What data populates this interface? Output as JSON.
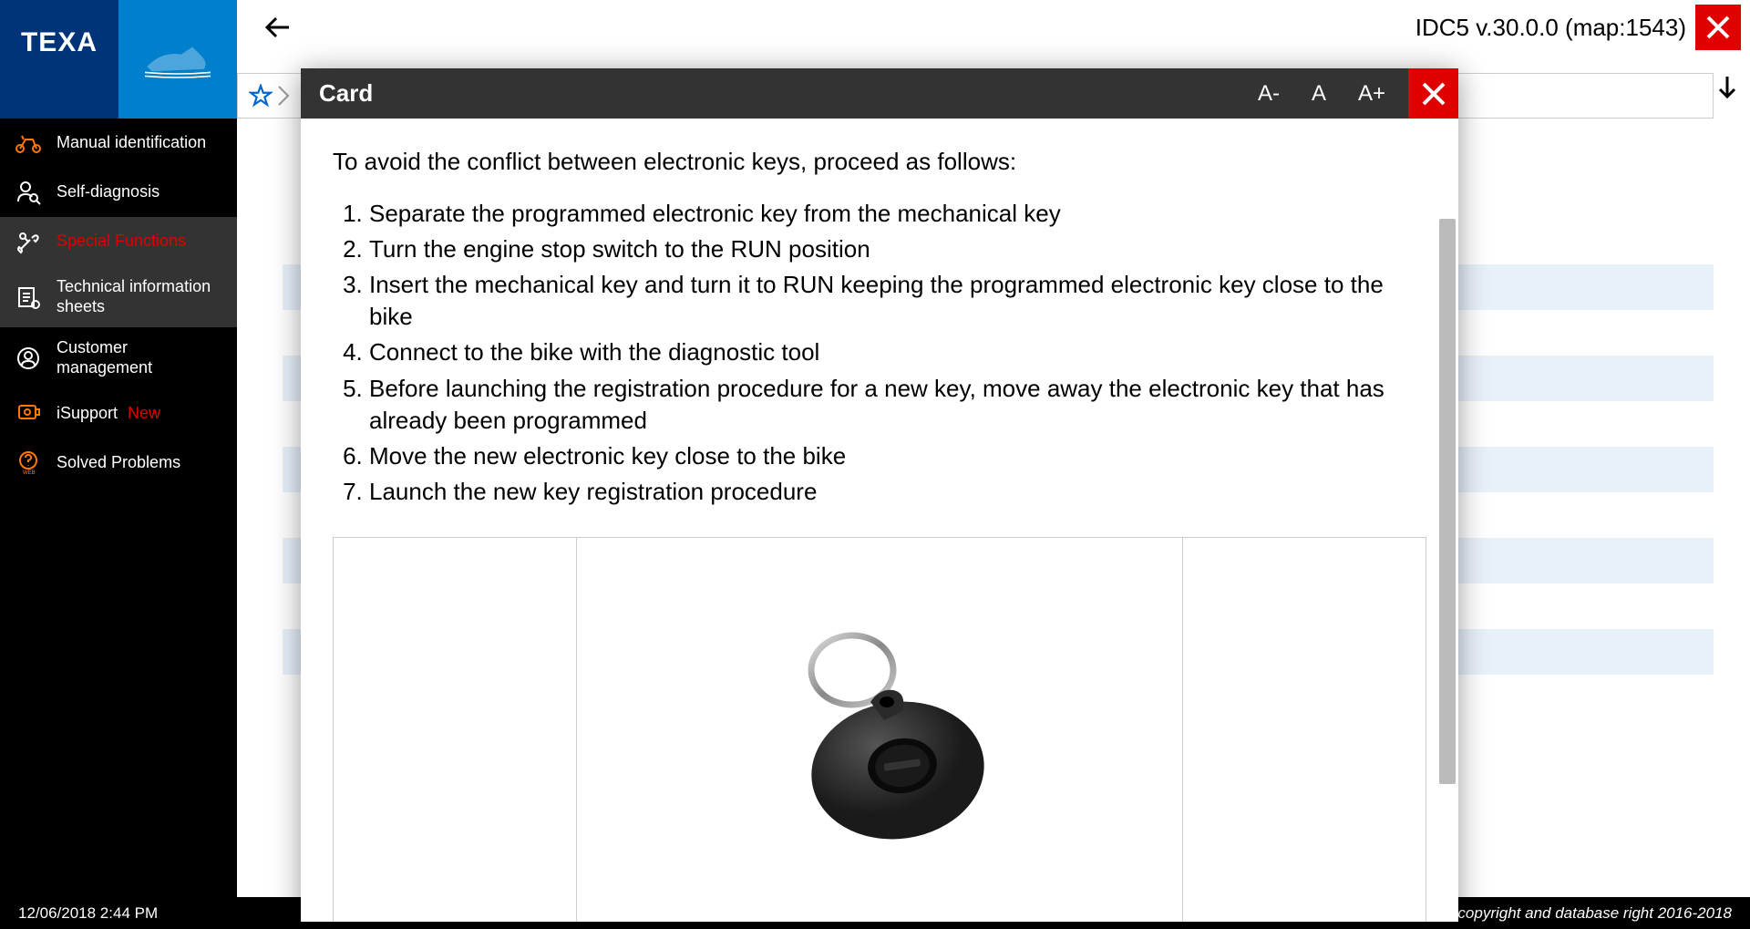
{
  "header": {
    "logo": "TEXA",
    "version": "IDC5 v.30.0.0 (map:1543)"
  },
  "sidebar": {
    "items": [
      {
        "label": "Manual identification",
        "icon": "motorcycle",
        "active": false
      },
      {
        "label": "Self-diagnosis",
        "icon": "person",
        "active": false
      },
      {
        "label": "Special Functions",
        "icon": "tools",
        "active": true
      },
      {
        "label": "Technical information sheets",
        "icon": "sheets",
        "active": false,
        "highlighted": true
      },
      {
        "label": "Customer management",
        "icon": "customer",
        "active": false
      },
      {
        "label": "iSupport ",
        "icon": "support",
        "active": false,
        "new": "New"
      },
      {
        "label": "Solved Problems",
        "icon": "help",
        "active": false
      }
    ]
  },
  "modal": {
    "title": "Card",
    "font_minus": "A-",
    "font_normal": "A",
    "font_plus": "A+",
    "intro": "To avoid the conflict between electronic keys, proceed as follows:",
    "steps": [
      "Separate the programmed electronic key from the mechanical key",
      "Turn the engine stop switch to the RUN position",
      "Insert the mechanical key and turn it to RUN keeping the programmed electronic key close to the bike",
      "Connect to the bike with the diagnostic tool",
      "Before launching the registration procedure for a new key, move away the electronic key that has already been programmed",
      "Move the new electronic key close to the bike",
      "Launch the new key registration procedure"
    ]
  },
  "footer": {
    "datetime": "12/06/2018 2:44 PM",
    "copyright": "© copyright and database right 2016-2018"
  }
}
